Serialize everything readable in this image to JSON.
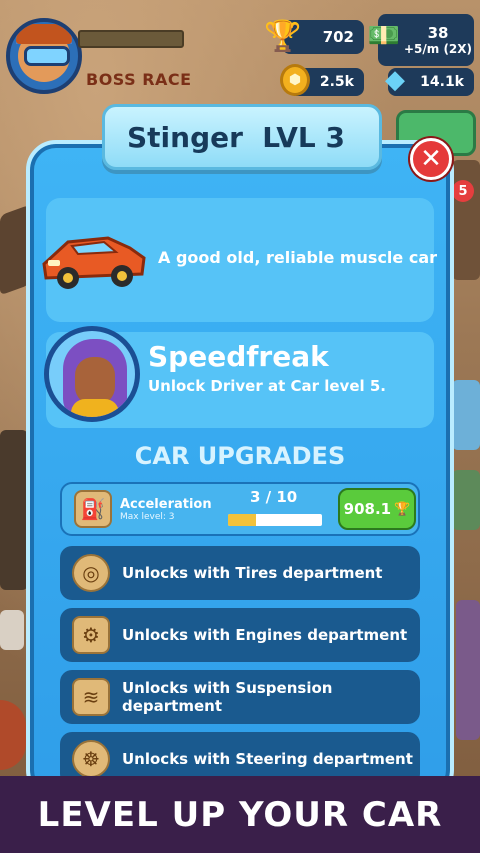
{
  "hud": {
    "boss_label": "BOSS RACE",
    "trophies": "702",
    "cash": "38",
    "cash_rate": "+5/m (2X)",
    "gold": "2.5k",
    "gems": "14.1k",
    "side_badge": "5",
    "boss_progress": 0.0
  },
  "panel": {
    "car_name": "Stinger",
    "car_level": "LVL 3",
    "car_description": "A good old, reliable muscle car",
    "driver_name": "Speedfreak",
    "driver_unlock": "Unlock Driver at Car level 5.",
    "section_title": "CAR UPGRADES"
  },
  "upgrades": {
    "acceleration": {
      "name": "Acceleration",
      "max_level": "Max level: 3",
      "level_text": "3 / 10",
      "progress": 0.3,
      "cost": "908.1"
    },
    "locked": [
      {
        "label": "Unlocks with Tires department",
        "icon": "tire-icon"
      },
      {
        "label": "Unlocks with Engines department",
        "icon": "engine-icon"
      },
      {
        "label": "Unlocks with Suspension department",
        "icon": "spring-icon"
      },
      {
        "label": "Unlocks with Steering department",
        "icon": "steering-wheel-icon"
      }
    ]
  },
  "banner": {
    "text": "LEVEL UP YOUR CAR"
  },
  "colors": {
    "panel": "#3fb4f5",
    "close": "#e53a3a",
    "buy": "#5acb3c"
  }
}
